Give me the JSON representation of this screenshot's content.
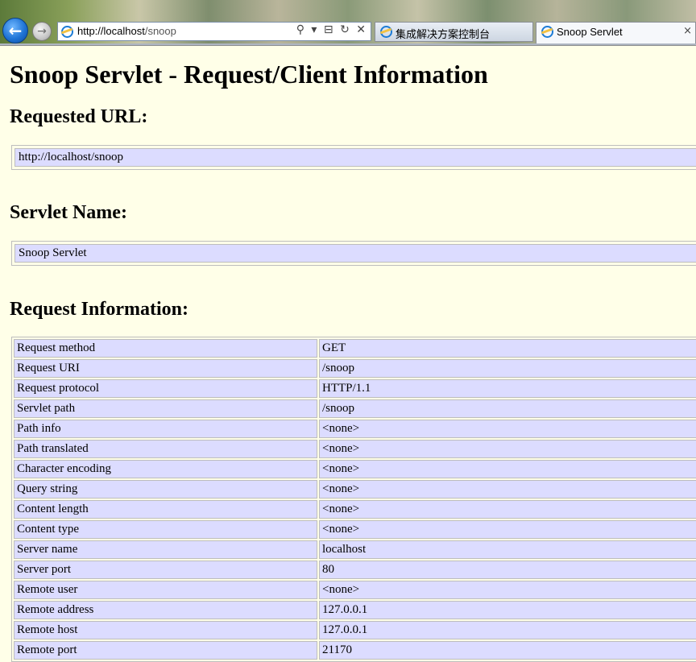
{
  "browser": {
    "address_url_host": "http://localhost",
    "address_url_path": "/snoop",
    "address_tools": "⚲ ▾ ⊟ ↻ ✕",
    "tabs": [
      {
        "label": "集成解决方案控制台"
      },
      {
        "label": "Snoop Servlet"
      }
    ],
    "close_tab_glyph": "×"
  },
  "page": {
    "title": "Snoop Servlet - Request/Client Information",
    "requested_url_heading": "Requested URL:",
    "requested_url_value": "http://localhost/snoop",
    "servlet_name_heading": "Servlet Name:",
    "servlet_name_value": "Snoop Servlet",
    "request_info_heading": "Request Information:",
    "request_info": [
      {
        "key": "Request method",
        "value": "GET"
      },
      {
        "key": "Request URI",
        "value": "/snoop"
      },
      {
        "key": "Request protocol",
        "value": "HTTP/1.1"
      },
      {
        "key": "Servlet path",
        "value": "/snoop"
      },
      {
        "key": "Path info",
        "value": "<none>"
      },
      {
        "key": "Path translated",
        "value": "<none>"
      },
      {
        "key": "Character encoding",
        "value": "<none>"
      },
      {
        "key": "Query string",
        "value": "<none>"
      },
      {
        "key": "Content length",
        "value": "<none>"
      },
      {
        "key": "Content type",
        "value": "<none>"
      },
      {
        "key": "Server name",
        "value": "localhost"
      },
      {
        "key": "Server port",
        "value": "80"
      },
      {
        "key": "Remote user",
        "value": "<none>"
      },
      {
        "key": "Remote address",
        "value": "127.0.0.1"
      },
      {
        "key": "Remote host",
        "value": "127.0.0.1"
      },
      {
        "key": "Remote port",
        "value": "21170"
      }
    ]
  },
  "colors": {
    "page_background": "#ffffe8",
    "cell_background": "#dcdcff"
  }
}
